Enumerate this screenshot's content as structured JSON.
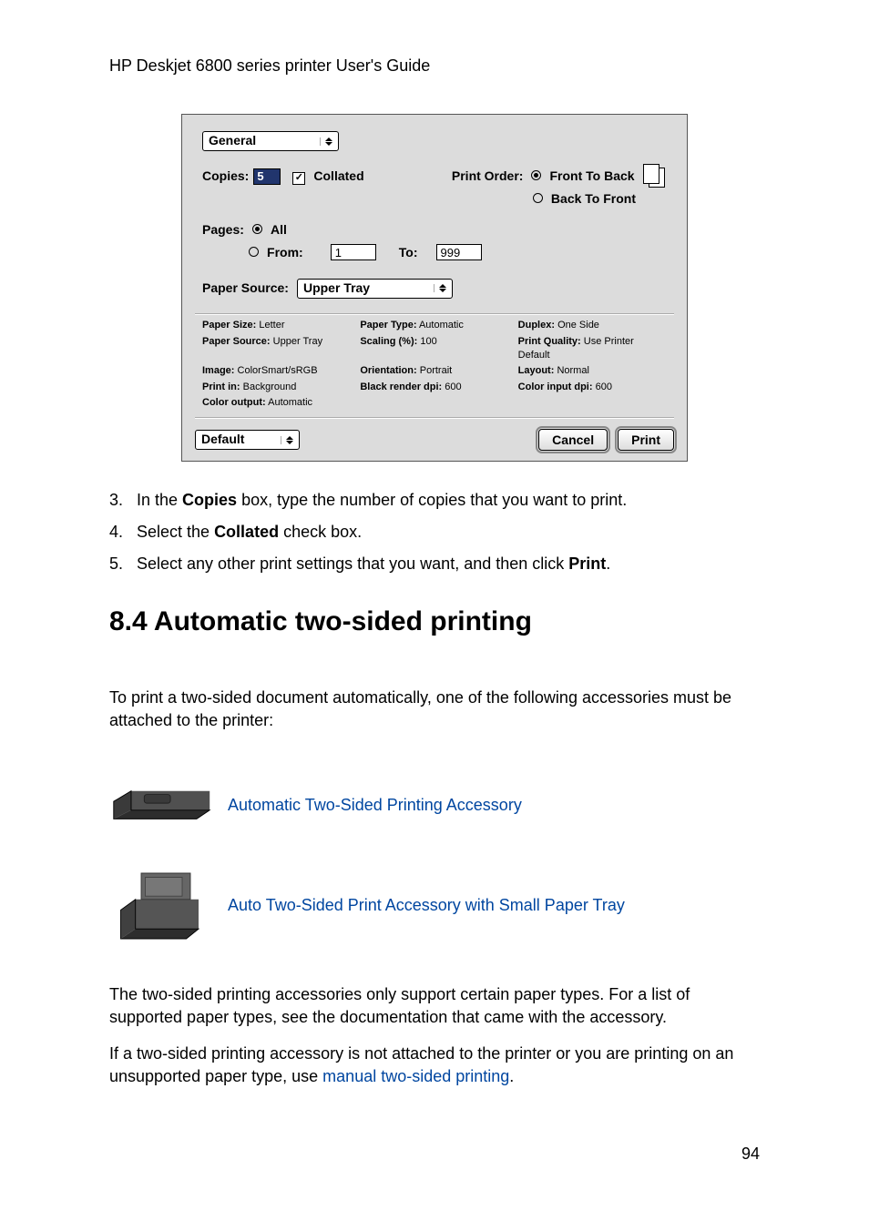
{
  "header": {
    "title": "HP Deskjet 6800 series printer User's Guide"
  },
  "dialog": {
    "panel_selected": "General",
    "copies_label": "Copies:",
    "copies_value": "5",
    "collated_label": "Collated",
    "print_order_label": "Print Order:",
    "front_to_back": "Front To Back",
    "back_to_front": "Back To Front",
    "pages_label": "Pages:",
    "all_label": "All",
    "from_label": "From:",
    "from_value": "1",
    "to_label": "To:",
    "to_value": "999",
    "paper_source_label": "Paper Source:",
    "paper_source_value": "Upper Tray",
    "summary": {
      "paper_size_k": "Paper Size:",
      "paper_size_v": "Letter",
      "paper_type_k": "Paper Type:",
      "paper_type_v": "Automatic",
      "duplex_k": "Duplex:",
      "duplex_v": "One Side",
      "paper_source_k": "Paper Source:",
      "paper_source_v": "Upper Tray",
      "scaling_k": "Scaling (%):",
      "scaling_v": "100",
      "print_quality_k": "Print Quality:",
      "print_quality_v": "Use Printer Default",
      "image_k": "Image:",
      "image_v": "ColorSmart/sRGB",
      "orientation_k": "Orientation:",
      "orientation_v": "Portrait",
      "layout_k": "Layout:",
      "layout_v": "Normal",
      "print_in_k": "Print in:",
      "print_in_v": "Background",
      "black_dpi_k": "Black render dpi:",
      "black_dpi_v": "600",
      "color_dpi_k": "Color input dpi:",
      "color_dpi_v": "600",
      "color_output_k": "Color output:",
      "color_output_v": "Automatic"
    },
    "preset_label": "Default",
    "cancel_label": "Cancel",
    "print_label": "Print"
  },
  "steps": {
    "s3_num": "3.",
    "s3_a": "In the ",
    "s3_b": "Copies",
    "s3_c": " box, type the number of copies that you want to print.",
    "s4_num": "4.",
    "s4_a": "Select the ",
    "s4_b": "Collated",
    "s4_c": " check box.",
    "s5_num": "5.",
    "s5_a": "Select any other print settings that you want, and then click ",
    "s5_b": "Print",
    "s5_c": "."
  },
  "section": {
    "heading": "8.4  Automatic two-sided printing"
  },
  "intro": "To print a two-sided document automatically, one of the following accessories must be attached to the printer:",
  "links": {
    "accessory1": "Automatic Two-Sided Printing Accessory",
    "accessory2": "Auto Two-Sided Print Accessory with Small Paper Tray",
    "manual": "manual two-sided printing"
  },
  "para1": "The two-sided printing accessories only support certain paper types. For a list of supported paper types, see the documentation that came with the accessory.",
  "para2_a": "If a two-sided printing accessory is not attached to the printer or you are printing on an unsupported paper type, use ",
  "para2_c": ".",
  "page_number": "94"
}
